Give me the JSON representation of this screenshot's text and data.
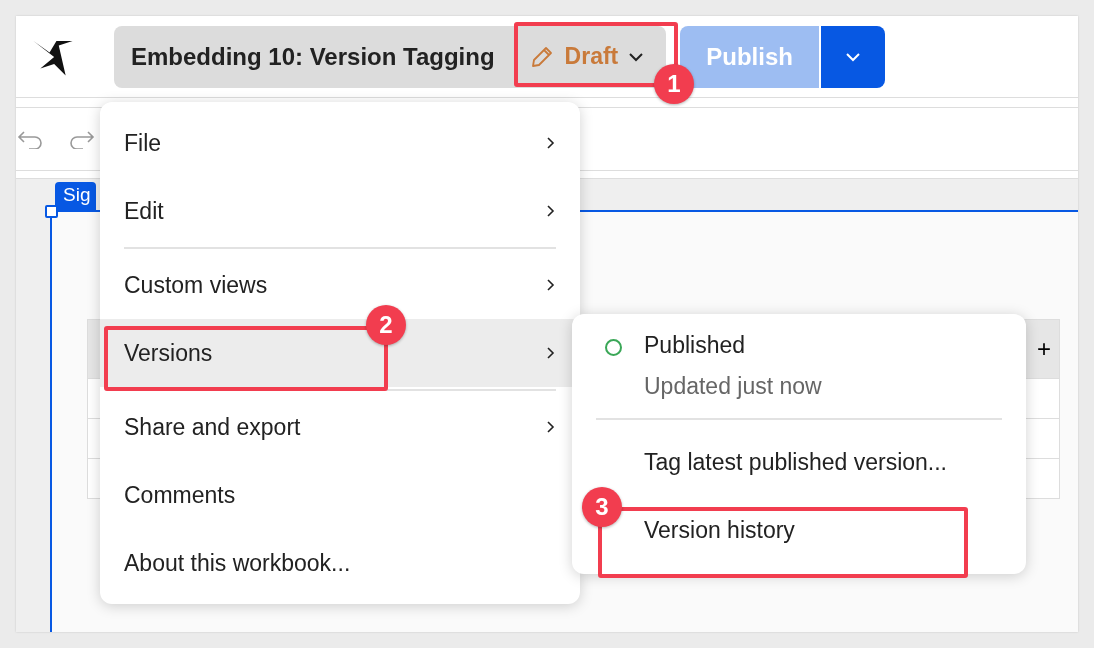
{
  "header": {
    "title": "Embedding 10: Version Tagging",
    "status": "Draft",
    "publish_button": "Publish"
  },
  "canvas": {
    "element_tag": "Sig",
    "table": {
      "add_column": "+"
    }
  },
  "menu": {
    "items": [
      {
        "kind": "item",
        "label": "File",
        "submenu": true,
        "selected": false
      },
      {
        "kind": "item",
        "label": "Edit",
        "submenu": true,
        "selected": false
      },
      {
        "kind": "divider"
      },
      {
        "kind": "item",
        "label": "Custom views",
        "submenu": true,
        "selected": false
      },
      {
        "kind": "item",
        "label": "Versions",
        "submenu": true,
        "selected": true
      },
      {
        "kind": "divider"
      },
      {
        "kind": "item",
        "label": "Share and export",
        "submenu": true,
        "selected": false
      },
      {
        "kind": "item",
        "label": "Comments",
        "submenu": false,
        "selected": false
      },
      {
        "kind": "item",
        "label": "About this workbook...",
        "submenu": false,
        "selected": false
      }
    ]
  },
  "versions_menu": {
    "status": {
      "label": "Published",
      "detail": "Updated just now"
    },
    "items": [
      "Tag latest published version...",
      "Version history"
    ]
  },
  "annotations": [
    {
      "number": "1"
    },
    {
      "number": "2"
    },
    {
      "number": "3"
    }
  ]
}
